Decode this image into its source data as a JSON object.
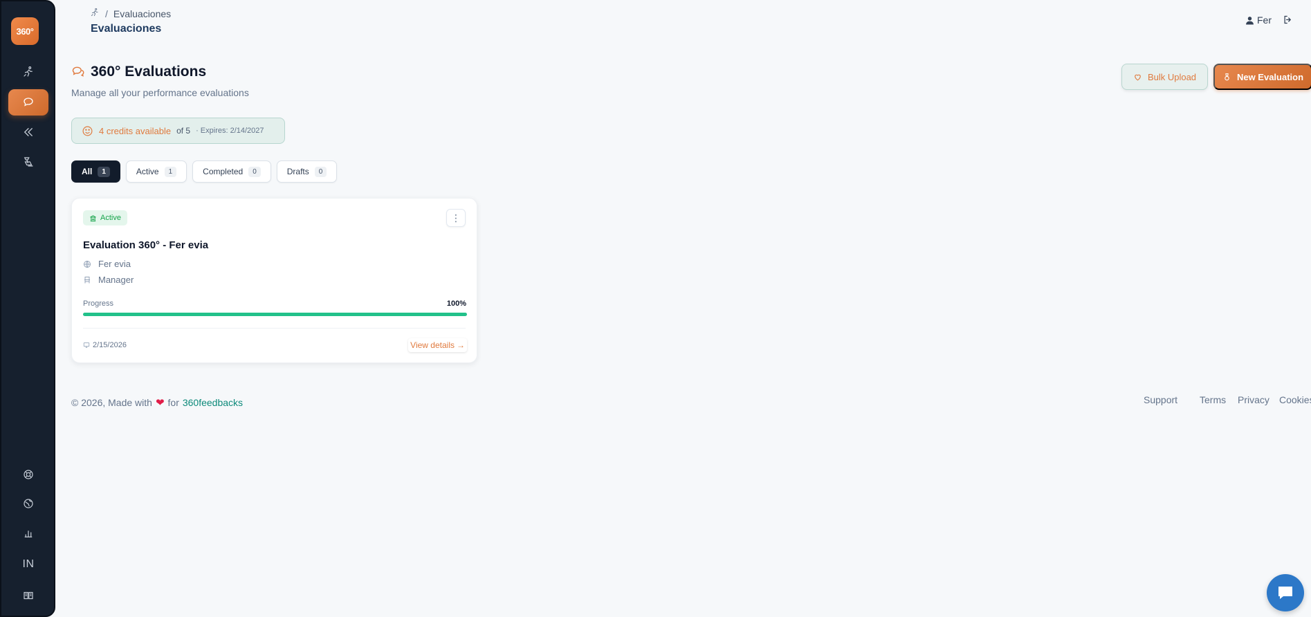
{
  "sidebar": {
    "logo_text": "360°",
    "bottom_text_item": "IN",
    "items": [
      {
        "icon": "runner-icon"
      },
      {
        "icon": "chat-bubbles-icon",
        "active": true
      },
      {
        "icon": "collapse-icon"
      },
      {
        "icon": "gavel-icon"
      }
    ],
    "bottom_items": [
      {
        "icon": "help-lifebuoy-icon"
      },
      {
        "icon": "globe-icon"
      },
      {
        "icon": "bar-chart-icon"
      },
      {
        "icon": "language-text"
      },
      {
        "icon": "book-icon"
      }
    ]
  },
  "topbar": {
    "breadcrumb_sep": "/",
    "breadcrumb_current": "Evaluaciones",
    "title": "Evaluaciones",
    "user_name": "Fer"
  },
  "header": {
    "title": "360° Evaluations",
    "subtitle": "Manage all your performance evaluations",
    "bulk_upload_label": "Bulk Upload",
    "new_evaluation_label": "New Evaluation"
  },
  "credits": {
    "available": "4 credits available",
    "of_total": "of 5",
    "expires": "· Expires: 2/14/2027"
  },
  "tabs": [
    {
      "label": "All",
      "count": "1",
      "active": true
    },
    {
      "label": "Active",
      "count": "1"
    },
    {
      "label": "Completed",
      "count": "0"
    },
    {
      "label": "Drafts",
      "count": "0"
    }
  ],
  "card": {
    "status": "Active",
    "title": "Evaluation 360° - Fer evia",
    "person": "Fer evia",
    "role": "Manager",
    "progress_label": "Progress",
    "progress_value": "100%",
    "progress_fraction": 1.0,
    "date": "2/15/2026",
    "view_details": "View details"
  },
  "footer": {
    "prefix": "© 2026, Made with",
    "for": "for",
    "brand": "360feedbacks",
    "links": [
      "Support",
      "Terms",
      "Privacy",
      "Cookies"
    ]
  },
  "colors": {
    "accent": "#e07a3e",
    "sidebar": "#16202e",
    "progress": "#22c18a",
    "status_green": "#16a34a",
    "brand_teal": "#0d8a7a",
    "chat": "#2c78c8"
  }
}
